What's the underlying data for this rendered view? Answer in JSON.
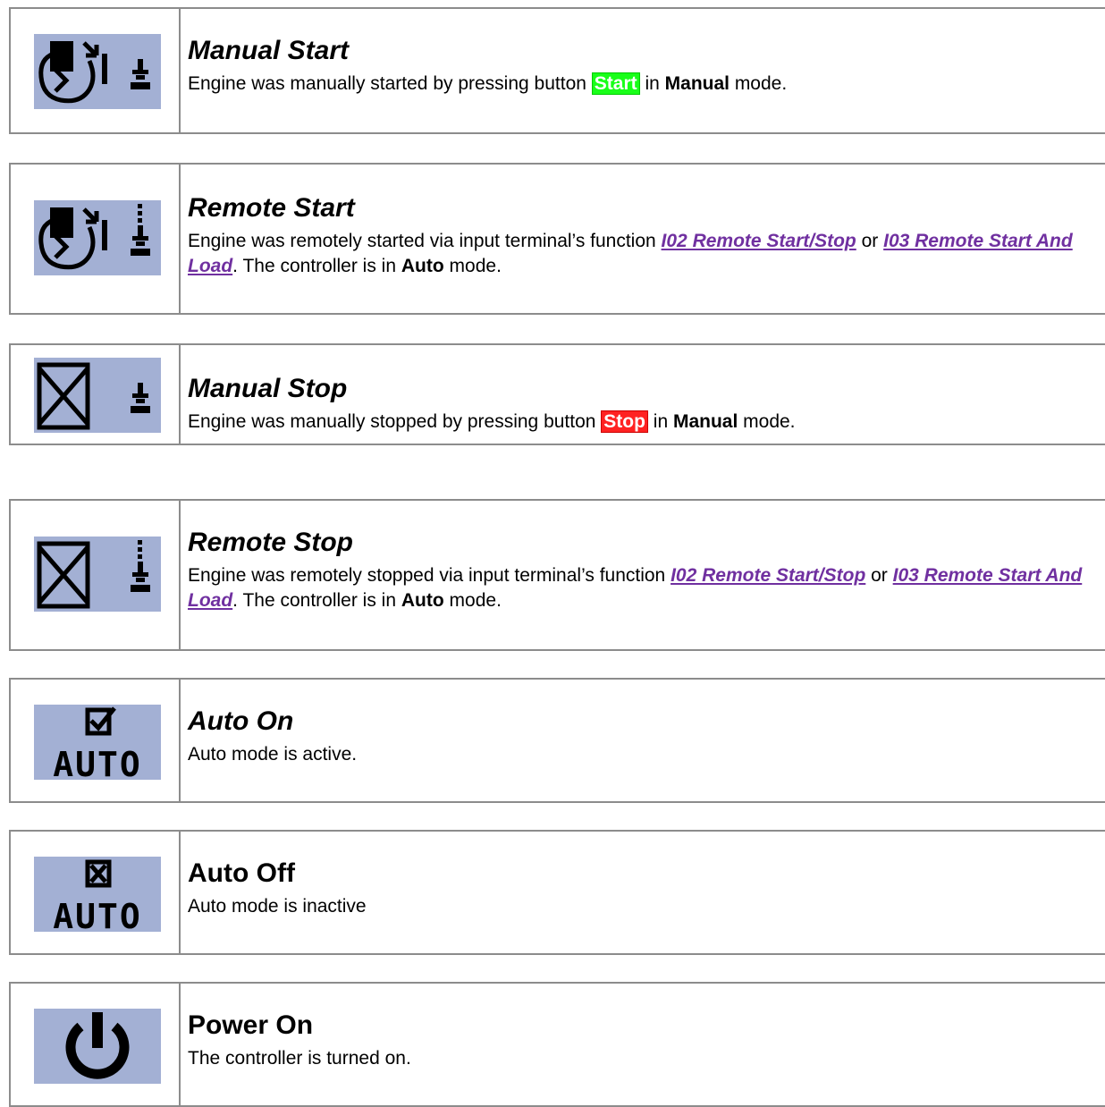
{
  "rows": [
    {
      "icon": "manual-start-icon",
      "title": "Manual Start",
      "desc": {
        "p1": "Engine was manually started by pressing button ",
        "btn": "Start",
        "p2": " in ",
        "bold": "Manual",
        "p3": " mode."
      }
    },
    {
      "icon": "remote-start-icon",
      "title": "Remote Start",
      "desc": {
        "p1": "Engine was remotely started via input terminal’s function ",
        "link1": "I02 Remote Start/Stop",
        "p2": " or ",
        "link2": "I03 Remote Start And Load",
        "p3": ". The controller is in ",
        "bold": "Auto",
        "p4": " mode."
      }
    },
    {
      "icon": "manual-stop-icon",
      "title": "Manual Stop",
      "desc": {
        "p1": "Engine was manually stopped by pressing button ",
        "btn": "Stop",
        "p2": " in ",
        "bold": "Manual",
        "p3": " mode."
      }
    },
    {
      "icon": "remote-stop-icon",
      "title": "Remote Stop",
      "desc": {
        "p1": "Engine was remotely stopped via input terminal’s function ",
        "link1": "I02 Remote Start/Stop",
        "p2": " or ",
        "link2": "I03 Remote Start And Load",
        "p3": ". The controller is in ",
        "bold": "Auto",
        "p4": " mode."
      }
    },
    {
      "icon": "auto-on-icon",
      "icon_text": "AUTO",
      "title": "Auto On",
      "desc": {
        "p1": "Auto mode is active."
      }
    },
    {
      "icon": "auto-off-icon",
      "icon_text": "AUTO",
      "title": "Auto Off",
      "desc": {
        "p1": "Auto mode is inactive"
      }
    },
    {
      "icon": "power-on-icon",
      "title": "Power On",
      "desc": {
        "p1": "The controller is turned on."
      }
    }
  ],
  "colors": {
    "icon_bg": "#a3b0d4",
    "start_button": "#19ff19",
    "stop_button": "#ff2222",
    "link": "#7030a0"
  }
}
